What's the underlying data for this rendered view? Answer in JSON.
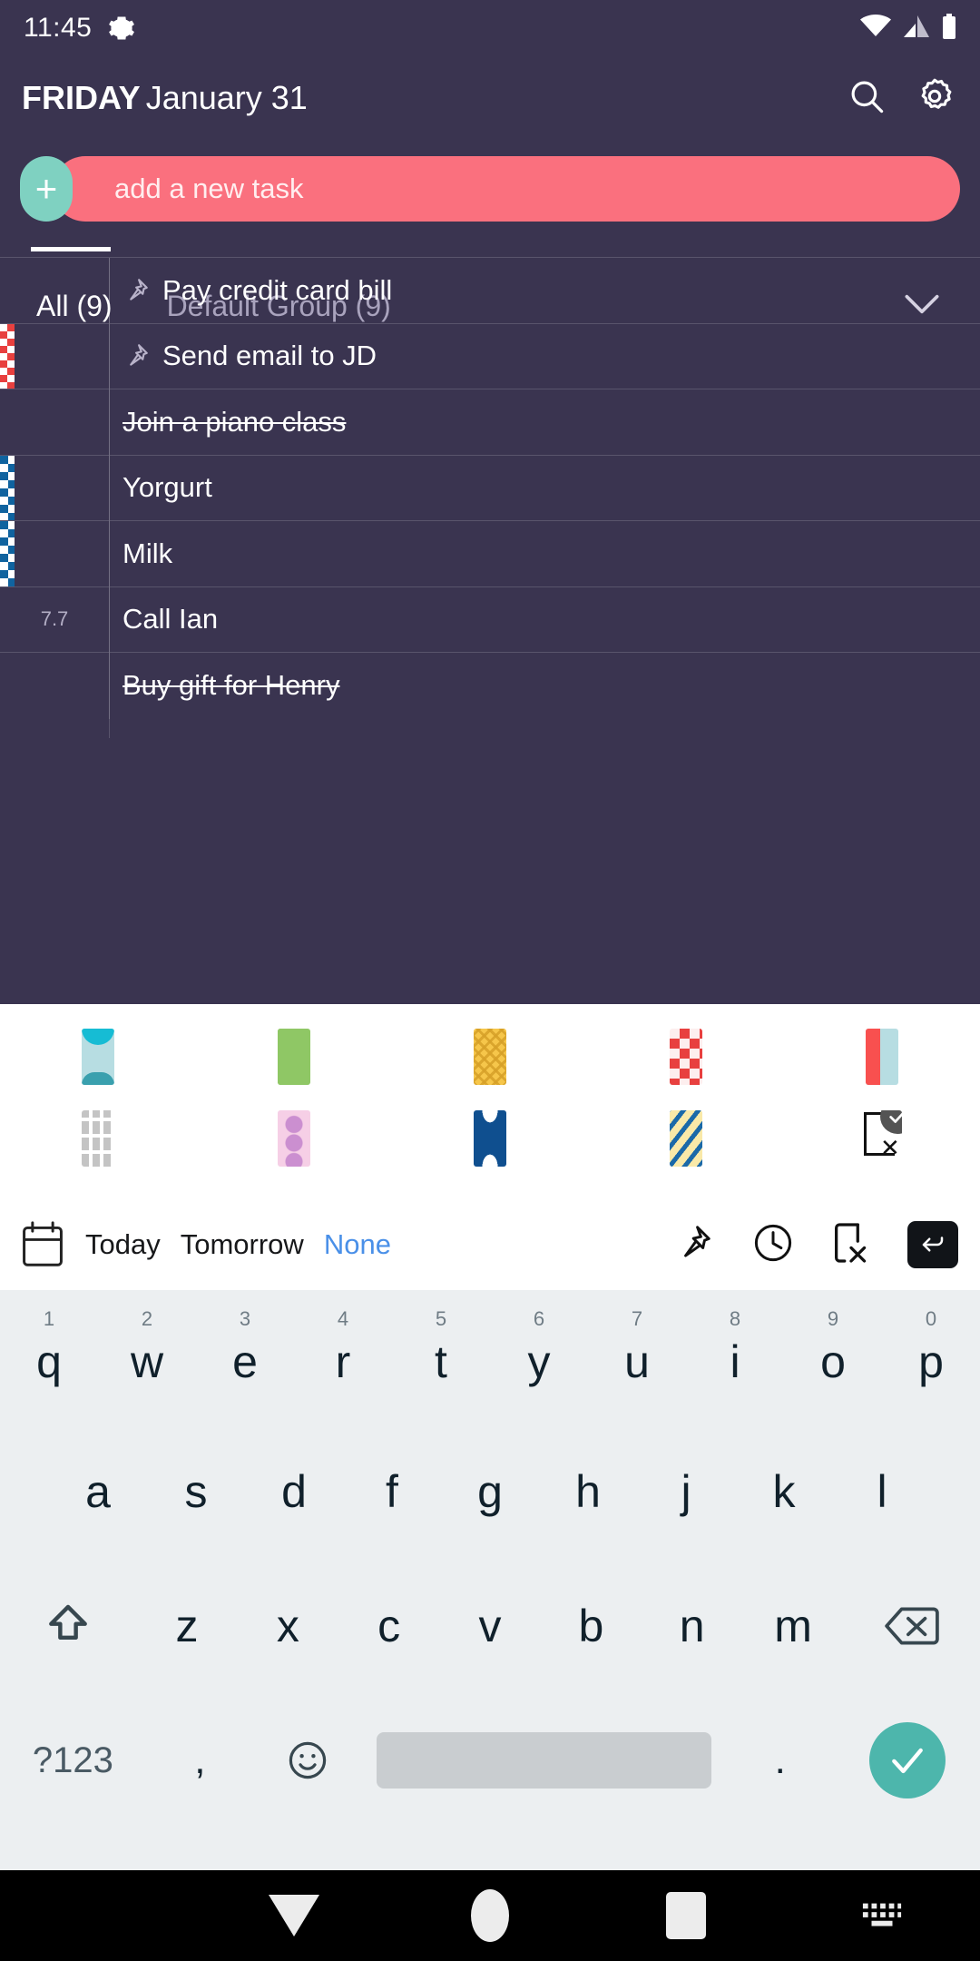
{
  "status_bar": {
    "time": "11:45",
    "gear_icon": "gear-icon",
    "wifi_icon": "wifi-icon",
    "signal_icon": "cell-signal-icon",
    "battery_icon": "battery-icon"
  },
  "header": {
    "day_of_week": "FRIDAY",
    "date": "January 31",
    "search_icon": "search-icon",
    "settings_icon": "gear-icon"
  },
  "add_task": {
    "plus_label": "+",
    "placeholder": "add a new task",
    "value": "",
    "pill_color": "#fa707e",
    "fab_color": "#7fd1c1"
  },
  "tabs": {
    "items": [
      {
        "label": "All (9)",
        "active": true
      },
      {
        "label": "Default Group (9)",
        "active": false
      }
    ],
    "expand_icon": "chevron-down-icon"
  },
  "tasks": [
    {
      "date": "",
      "title": "Pay credit card bill",
      "pinned": true,
      "done": false,
      "marker": "none"
    },
    {
      "date": "",
      "title": "Send email to JD",
      "pinned": true,
      "done": false,
      "marker": "checker-red"
    },
    {
      "date": "",
      "title": "Join a piano class",
      "pinned": false,
      "done": true,
      "marker": "none"
    },
    {
      "date": "",
      "title": "Yorgurt",
      "pinned": false,
      "done": false,
      "marker": "diamond-blue"
    },
    {
      "date": "",
      "title": "Milk",
      "pinned": false,
      "done": false,
      "marker": "diamond-blue"
    },
    {
      "date": "7.7",
      "title": "Call Ian",
      "pinned": false,
      "done": false,
      "marker": "none"
    },
    {
      "date": "",
      "title": "Buy gift for Henry",
      "pinned": false,
      "done": true,
      "marker": "none"
    }
  ],
  "pattern_picker": {
    "row1": [
      {
        "name": "swatch-teal-hourglass",
        "selected": false
      },
      {
        "name": "swatch-green-grid",
        "selected": false
      },
      {
        "name": "swatch-yellow-chevron",
        "selected": false
      },
      {
        "name": "swatch-red-checker",
        "selected": false
      },
      {
        "name": "swatch-red-teal-split",
        "selected": false
      }
    ],
    "row2": [
      {
        "name": "swatch-gray-grid",
        "selected": false
      },
      {
        "name": "swatch-pink-dots",
        "selected": false
      },
      {
        "name": "swatch-navy-hourglass",
        "selected": false
      },
      {
        "name": "swatch-yellow-stripe",
        "selected": false
      },
      {
        "name": "swatch-none",
        "selected": true
      }
    ]
  },
  "options_toolbar": {
    "calendar_icon": "calendar-icon",
    "chips": [
      {
        "label": "Today",
        "selected": false
      },
      {
        "label": "Tomorrow",
        "selected": false
      },
      {
        "label": "None",
        "selected": true
      }
    ],
    "selected_color": "#4a90e8",
    "pin_icon": "pin-icon",
    "clock_icon": "clock-icon",
    "no_repeat_icon": "no-repeat-icon",
    "enter_icon": "enter-key-icon"
  },
  "keyboard": {
    "row1": [
      {
        "key": "q",
        "num": "1"
      },
      {
        "key": "w",
        "num": "2"
      },
      {
        "key": "e",
        "num": "3"
      },
      {
        "key": "r",
        "num": "4"
      },
      {
        "key": "t",
        "num": "5"
      },
      {
        "key": "y",
        "num": "6"
      },
      {
        "key": "u",
        "num": "7"
      },
      {
        "key": "i",
        "num": "8"
      },
      {
        "key": "o",
        "num": "9"
      },
      {
        "key": "p",
        "num": "0"
      }
    ],
    "row2": [
      {
        "key": "a"
      },
      {
        "key": "s"
      },
      {
        "key": "d"
      },
      {
        "key": "f"
      },
      {
        "key": "g"
      },
      {
        "key": "h"
      },
      {
        "key": "j"
      },
      {
        "key": "k"
      },
      {
        "key": "l"
      }
    ],
    "row3": [
      {
        "key": "z"
      },
      {
        "key": "x"
      },
      {
        "key": "c"
      },
      {
        "key": "v"
      },
      {
        "key": "b"
      },
      {
        "key": "n"
      },
      {
        "key": "m"
      }
    ],
    "shift_icon": "shift-key-icon",
    "backspace_icon": "backspace-key-icon",
    "symbols_label": "?123",
    "comma_label": ",",
    "emoji_icon": "emoji-icon",
    "space_label": "",
    "period_label": ".",
    "enter_icon": "checkmark-key-icon",
    "enter_color": "#4db6ac"
  },
  "nav_bar": {
    "back_icon": "back-nav-icon",
    "home_icon": "home-nav-icon",
    "recents_icon": "recents-nav-icon",
    "keyboard_icon": "keyboard-nav-icon"
  },
  "colors": {
    "app_background": "#3a3450",
    "accent_pink": "#fa707e",
    "accent_teal": "#7fd1c1",
    "keyboard_background": "#eceff1"
  }
}
